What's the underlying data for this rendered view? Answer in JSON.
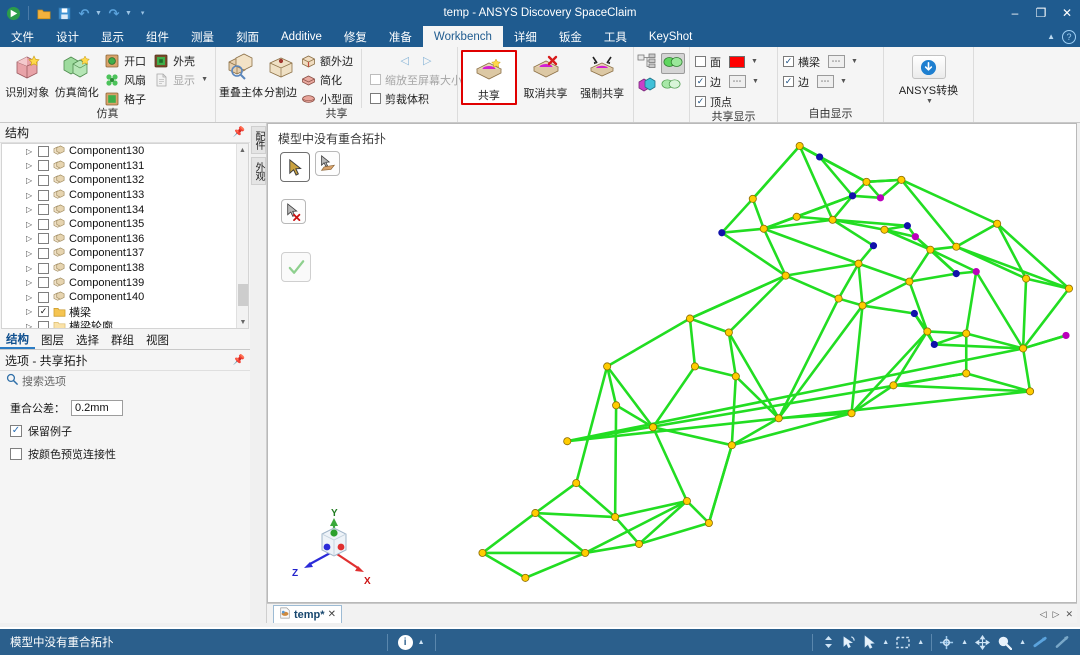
{
  "window": {
    "title": "temp - ANSYS Discovery SpaceClaim",
    "minimize": "–",
    "restore": "❐",
    "close": "✕"
  },
  "quick_access": {
    "app_icon": "app-logo-icon",
    "items": [
      {
        "name": "open-icon",
        "glyph": "📁"
      },
      {
        "name": "save-icon",
        "glyph": "💾"
      },
      {
        "name": "undo-icon",
        "glyph": "↶"
      },
      {
        "name": "redo-icon",
        "glyph": "↷"
      },
      {
        "name": "customize-qat-icon",
        "glyph": "≡"
      }
    ]
  },
  "menubar": {
    "items": [
      {
        "label": "文件",
        "active": false
      },
      {
        "label": "设计",
        "active": false
      },
      {
        "label": "显示",
        "active": false
      },
      {
        "label": "组件",
        "active": false
      },
      {
        "label": "测量",
        "active": false
      },
      {
        "label": "刻面",
        "active": false
      },
      {
        "label": "Additive",
        "active": false
      },
      {
        "label": "修复",
        "active": false
      },
      {
        "label": "准备",
        "active": false
      },
      {
        "label": "Workbench",
        "active": true
      },
      {
        "label": "详细",
        "active": false
      },
      {
        "label": "钣金",
        "active": false
      },
      {
        "label": "工具",
        "active": false
      },
      {
        "label": "KeyShot",
        "active": false
      }
    ],
    "collapse_label": "▲",
    "help_label": "?"
  },
  "ribbon": {
    "groups": [
      {
        "title": "仿真",
        "big_buttons": [
          {
            "label": "识别对象",
            "icon": "identify-object-icon"
          },
          {
            "label": "仿真简化",
            "icon": "simplify-simulation-icon"
          }
        ],
        "small_columns": [
          [
            {
              "label": "开口",
              "icon": "opening-icon",
              "type": "icon"
            },
            {
              "label": "风扇",
              "icon": "fan-icon",
              "type": "icon"
            },
            {
              "label": "格子",
              "icon": "grid-icon",
              "type": "icon"
            }
          ],
          [
            {
              "label": "外壳",
              "icon": "enclosure-icon",
              "type": "icon"
            },
            {
              "label": "显示",
              "icon": "show-icon",
              "type": "icon",
              "dropdown": true
            }
          ]
        ]
      },
      {
        "title": "共享",
        "big_buttons": [
          {
            "label": "重叠主体",
            "icon": "overlapping-bodies-icon"
          },
          {
            "label": "分割边",
            "icon": "split-edge-icon"
          }
        ],
        "small_columns": [
          [
            {
              "label": "额外边",
              "icon": "extra-edges-icon",
              "type": "icon"
            },
            {
              "label": "简化",
              "icon": "simplify-icon",
              "type": "icon"
            },
            {
              "label": "小型面",
              "icon": "small-faces-icon",
              "type": "icon"
            }
          ],
          [
            {
              "label": "",
              "icon": "nav-prev-next-icon",
              "type": "nav"
            },
            {
              "label": "缩放至屏幕大小",
              "icon": "zoom-to-screen-check",
              "type": "check",
              "checked": false,
              "disabled": true
            },
            {
              "label": "剪裁体积",
              "icon": "clip-volume-check",
              "type": "check",
              "checked": false,
              "disabled": false
            }
          ]
        ]
      },
      {
        "title": "",
        "big_buttons": [
          {
            "label": "共享",
            "icon": "share-icon",
            "highlighted": true
          },
          {
            "label": "取消共享",
            "icon": "unshare-icon"
          },
          {
            "label": "强制共享",
            "icon": "force-share-icon"
          }
        ],
        "small_columns": []
      },
      {
        "title": "",
        "toggle_icons": [
          {
            "name": "structure-tree-view-icon",
            "active": false
          },
          {
            "name": "shared-preview-icon",
            "active": true
          },
          {
            "name": "colored-body-icon",
            "active": false
          },
          {
            "name": "transparent-body-icon",
            "active": false
          }
        ]
      },
      {
        "title": "共享显示",
        "small_columns": [
          [
            {
              "label": "面",
              "type": "check",
              "checked": false,
              "swatch": "#ff0000",
              "dropdown": true
            },
            {
              "label": "边",
              "type": "check",
              "checked": true,
              "dots": true,
              "dropdown": true
            },
            {
              "label": "顶点",
              "type": "check",
              "checked": true
            }
          ]
        ]
      },
      {
        "title": "自由显示",
        "small_columns": [
          [
            {
              "label": "横梁",
              "type": "check",
              "checked": true,
              "dots": true,
              "dropdown": true
            },
            {
              "label": "边",
              "type": "check",
              "checked": true,
              "dots": true,
              "dropdown": true
            }
          ]
        ]
      },
      {
        "title": "",
        "big_buttons": [
          {
            "label": "ANSYS转换",
            "icon": "ansys-transfer-icon",
            "dropdown": true
          }
        ],
        "small_columns": []
      }
    ]
  },
  "structure_panel": {
    "title": "结构",
    "pin": "⚓",
    "items": [
      {
        "label": "Component130",
        "checked": false,
        "icon": "component-icon"
      },
      {
        "label": "Component131",
        "checked": false,
        "icon": "component-icon"
      },
      {
        "label": "Component132",
        "checked": false,
        "icon": "component-icon"
      },
      {
        "label": "Component133",
        "checked": false,
        "icon": "component-icon"
      },
      {
        "label": "Component134",
        "checked": false,
        "icon": "component-icon"
      },
      {
        "label": "Component135",
        "checked": false,
        "icon": "component-icon"
      },
      {
        "label": "Component136",
        "checked": false,
        "icon": "component-icon"
      },
      {
        "label": "Component137",
        "checked": false,
        "icon": "component-icon"
      },
      {
        "label": "Component138",
        "checked": false,
        "icon": "component-icon"
      },
      {
        "label": "Component139",
        "checked": false,
        "icon": "component-icon"
      },
      {
        "label": "Component140",
        "checked": false,
        "icon": "component-icon"
      },
      {
        "label": "横梁",
        "checked": true,
        "icon": "folder-icon"
      },
      {
        "label": "横梁轮廓",
        "checked": false,
        "icon": "folder-icon"
      }
    ],
    "tabs": [
      {
        "label": "结构",
        "active": true
      },
      {
        "label": "图层",
        "active": false
      },
      {
        "label": "选择",
        "active": false
      },
      {
        "label": "群组",
        "active": false
      },
      {
        "label": "视图",
        "active": false
      }
    ]
  },
  "options_panel": {
    "title": "选项 - 共享拓扑",
    "pin": "⚓",
    "search_placeholder": "搜索选项",
    "search_icon": "search-icon",
    "tolerance_label": "重合公差：",
    "tolerance_value": "0.2mm",
    "checkboxes": [
      {
        "label": "保留例子",
        "checked": true
      },
      {
        "label": "按颜色预览连接性",
        "checked": false
      }
    ]
  },
  "vertical_tabs": [
    {
      "label": "配件"
    },
    {
      "label": "外观"
    }
  ],
  "viewport": {
    "message": "模型中没有重合拓扑",
    "tools": [
      {
        "name": "select-tool-icon",
        "selected": true
      },
      {
        "name": "select-face-tool-icon",
        "selected": false
      },
      {
        "name": "deselect-tool-icon",
        "selected": false
      },
      {
        "name": "complete-check-icon",
        "selected": false
      }
    ],
    "axis_triad": {
      "x_label": "X",
      "y_label": "Y",
      "z_label": "Z",
      "x_color": "#ee2222",
      "y_color": "#22aa22",
      "z_color": "#2222dd"
    },
    "model": {
      "edge_color": "#22dd22",
      "vertex_colors": {
        "yellow": "#ffcc00",
        "blue": "#1111aa",
        "magenta": "#bb00bb"
      }
    }
  },
  "doc_tabs": {
    "tabs": [
      {
        "label": "temp*",
        "icon": "document-icon",
        "close": "✕"
      }
    ],
    "nav_prev": "◁",
    "nav_next": "▷",
    "nav_close": "✕"
  },
  "statusbar": {
    "message": "模型中没有重合拓扑",
    "info_label": "i",
    "tools": [
      {
        "name": "spin-updown-icon",
        "glyph": "↕"
      },
      {
        "name": "orbit-icon",
        "glyph": "↺"
      },
      {
        "name": "pan-select-icon",
        "glyph": "➤"
      },
      {
        "name": "box-select-icon",
        "glyph": "⬚"
      },
      {
        "name": "spin-icon",
        "glyph": "✚"
      },
      {
        "name": "pan-icon",
        "glyph": "✥"
      },
      {
        "name": "zoom-icon",
        "glyph": "⚲"
      },
      {
        "name": "zoom-extents-icon",
        "glyph": "↗"
      },
      {
        "name": "fit-icon",
        "glyph": "⤢"
      }
    ]
  }
}
